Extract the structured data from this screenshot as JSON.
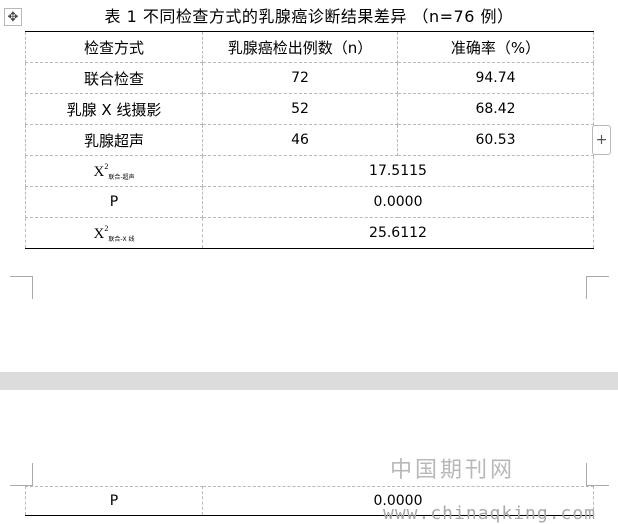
{
  "document": {
    "caption": "表 1 不同检查方式的乳腺癌诊断结果差异 （n=76 例）",
    "table": {
      "headers": [
        "检查方式",
        "乳腺癌检出例数（n）",
        "准确率（%）"
      ],
      "rows": [
        {
          "method": "联合检查",
          "detected": "72",
          "accuracy": "94.74"
        },
        {
          "method": "乳腺 X 线摄影",
          "detected": "52",
          "accuracy": "68.42"
        },
        {
          "method": "乳腺超声",
          "detected": "46",
          "accuracy": "60.53"
        }
      ],
      "stats": [
        {
          "symbol": "X",
          "sup": "2",
          "sub": "联合-超声",
          "value": "17.5115"
        },
        {
          "label": "P",
          "value": "0.0000"
        },
        {
          "symbol": "X",
          "sup": "2",
          "sub": "联合-X 线",
          "value": "25.6112"
        }
      ]
    },
    "next_page": {
      "label": "P",
      "value": "0.0000"
    }
  },
  "toolbar": {
    "move_glyph": "✥",
    "add_glyph": "+"
  },
  "watermark": {
    "cn": "中国期刊网",
    "url": "www.chinaqking.com"
  }
}
